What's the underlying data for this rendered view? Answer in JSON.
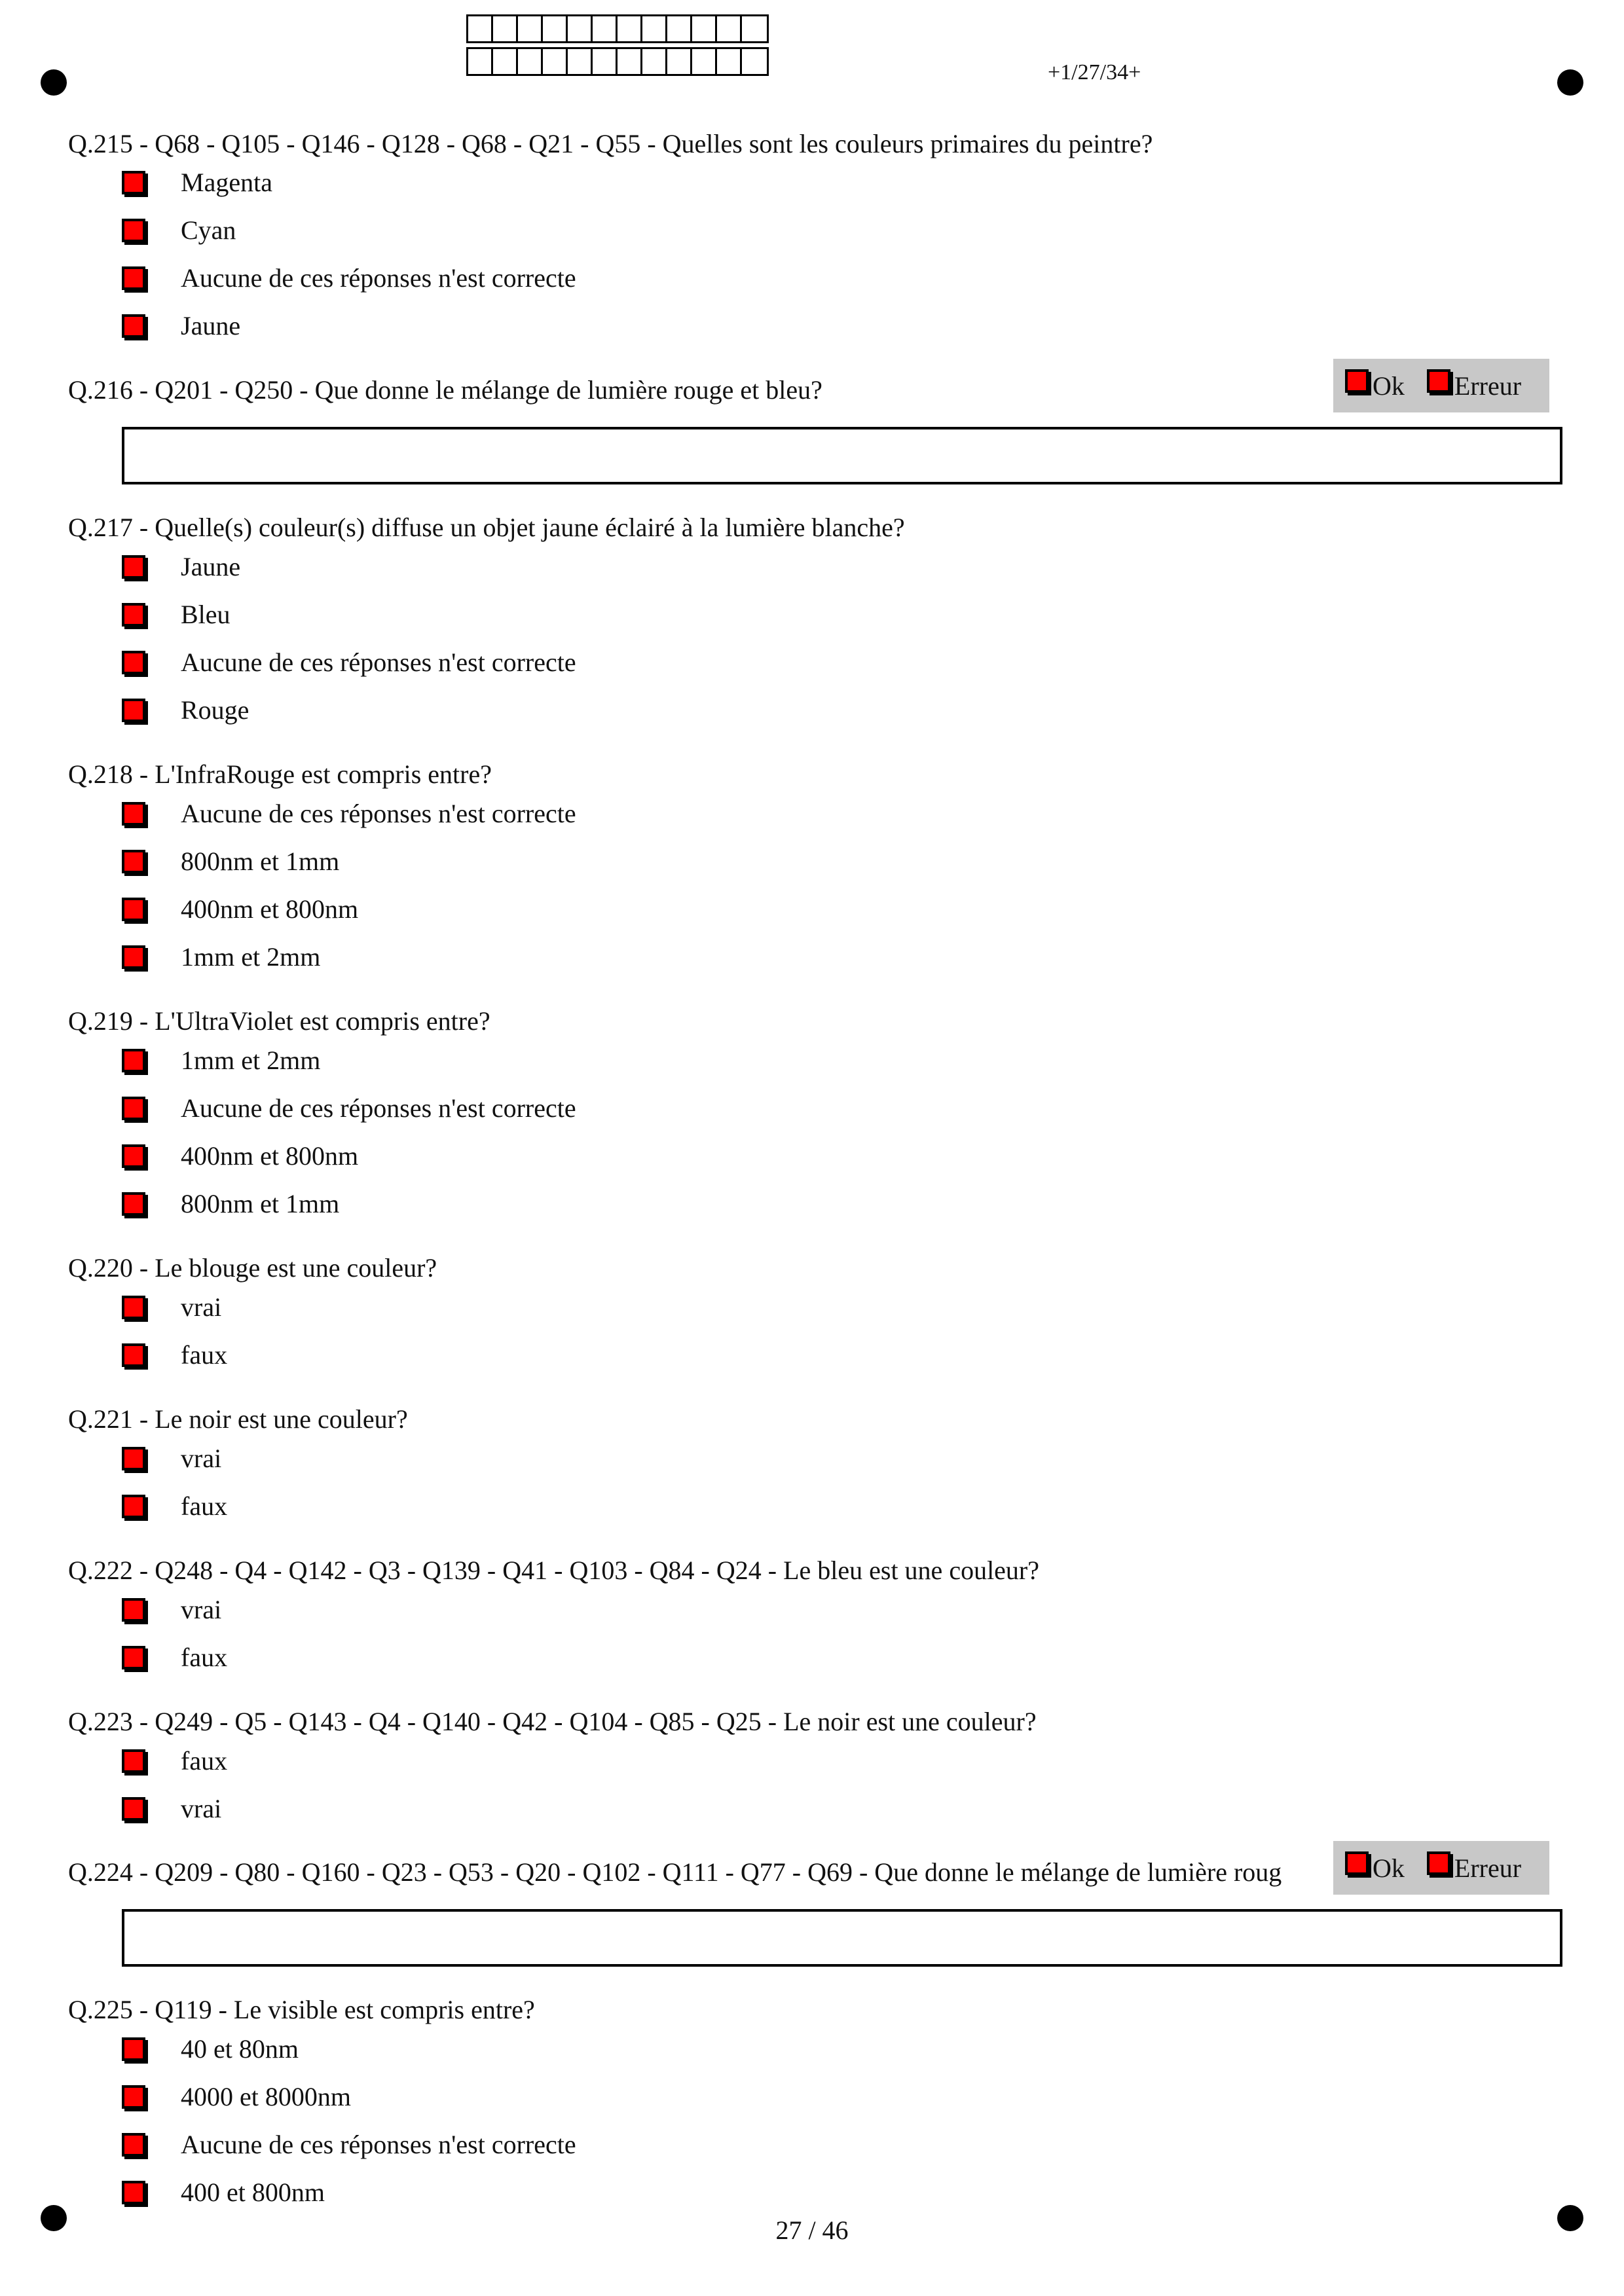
{
  "header": {
    "page_code": "+1/27/34+"
  },
  "footer": {
    "page_number": "27 / 46"
  },
  "grading": {
    "ok_label": "Ok",
    "error_label": "Erreur"
  },
  "questions": [
    {
      "text": "Q.215 - Q68 - Q105 - Q146 - Q128 - Q68 - Q21 - Q55 - Quelles sont les couleurs primaires du peintre?",
      "options": [
        "Magenta",
        "Cyan",
        "Aucune de ces réponses n'est correcte",
        "Jaune"
      ]
    },
    {
      "text": "Q.216 - Q201 - Q250 - Que donne le mélange de lumière rouge et bleu?",
      "options": []
    },
    {
      "text": "Q.217 - Quelle(s) couleur(s) diffuse un objet jaune éclairé à la lumière blanche?",
      "options": [
        "Jaune",
        "Bleu",
        "Aucune de ces réponses n'est correcte",
        "Rouge"
      ]
    },
    {
      "text": "Q.218 - L'InfraRouge est compris entre?",
      "options": [
        "Aucune de ces réponses n'est correcte",
        "800nm et 1mm",
        "400nm et 800nm",
        "1mm et 2mm"
      ]
    },
    {
      "text": "Q.219 - L'UltraViolet est compris entre?",
      "options": [
        "1mm et 2mm",
        "Aucune de ces réponses n'est correcte",
        "400nm et 800nm",
        "800nm et 1mm"
      ]
    },
    {
      "text": "Q.220 - Le blouge est une couleur?",
      "options": [
        "vrai",
        "faux"
      ]
    },
    {
      "text": "Q.221 - Le noir est une couleur?",
      "options": [
        "vrai",
        "faux"
      ]
    },
    {
      "text": "Q.222 - Q248 - Q4 - Q142 - Q3 - Q139 - Q41 - Q103 - Q84 - Q24 - Le bleu est une couleur?",
      "options": [
        "vrai",
        "faux"
      ]
    },
    {
      "text": "Q.223 - Q249 - Q5 - Q143 - Q4 - Q140 - Q42 - Q104 - Q85 - Q25 - Le noir est une couleur?",
      "options": [
        "faux",
        "vrai"
      ]
    },
    {
      "text": "Q.224 - Q209 - Q80 - Q160 - Q23 - Q53 - Q20 - Q102 - Q111 - Q77 - Q69 - Que donne le mélange de lumière roug",
      "options": []
    },
    {
      "text": "Q.225 - Q119 - Le visible est compris entre?",
      "options": [
        "40 et 80nm",
        "4000 et 8000nm",
        "Aucune de ces réponses n'est correcte",
        "400 et 800nm"
      ]
    }
  ]
}
